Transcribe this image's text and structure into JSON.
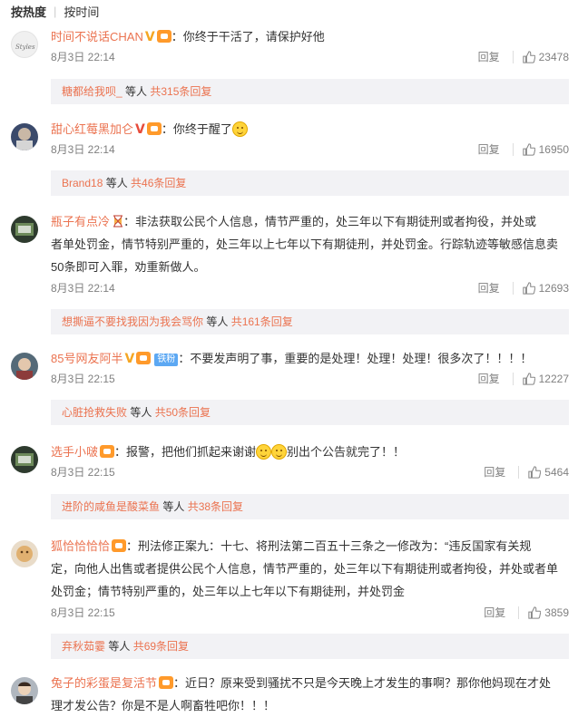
{
  "tabs": {
    "hot": "按热度",
    "time": "按时间"
  },
  "comments": [
    {
      "user": "时间不说话CHAN",
      "text": "：你终于干活了，请保护好他",
      "time": "8月3日 22:14",
      "reply_label": "回复",
      "likes": "23478",
      "sub": {
        "users": "糖都给我呗_",
        "mid": " 等人 ",
        "count": "共315条回复"
      }
    },
    {
      "user": "甜心红莓黑加仑",
      "text": "：你终于醒了",
      "time": "8月3日 22:14",
      "reply_label": "回复",
      "likes": "16950",
      "sub": {
        "users": "Brand18",
        "mid": " 等人 ",
        "count": "共46条回复"
      }
    },
    {
      "user": "瓶子有点冷",
      "text_line1": "：非法获取公民个人信息，情节严重的，处三年以下有期徒刑或者拘役，并处或",
      "text_line2": "者单处罚金，情节特别严重的，处三年以上七年以下有期徒刑，并处罚金。行踪轨迹等敏感信息卖",
      "text_line3": "50条即可入罪，劝重新做人。",
      "time": "8月3日 22:14",
      "reply_label": "回复",
      "likes": "12693",
      "sub": {
        "users": "想撕逼不要找我因为我会骂你",
        "mid": " 等人 ",
        "count": "共161条回复"
      }
    },
    {
      "user": "85号网友阿半",
      "tag": "铁粉",
      "text": "：不要发声明了事，重要的是处理！处理！处理！很多次了！！！！",
      "time": "8月3日 22:15",
      "reply_label": "回复",
      "likes": "12227",
      "sub": {
        "users": "心脏抢救失败",
        "mid": " 等人 ",
        "count": "共50条回复"
      }
    },
    {
      "user": "选手小啵",
      "text_a": "：报警，把他们抓起来谢谢",
      "text_b": "别出个公告就完了！！",
      "time": "8月3日 22:15",
      "reply_label": "回复",
      "likes": "5464",
      "sub": {
        "users": "进阶的咸鱼是酸菜鱼",
        "mid": " 等人 ",
        "count": "共38条回复"
      }
    },
    {
      "user": "狐恰恰恰恰",
      "text_line1": "：刑法修正案九：十七、将刑法第二百五十三条之一修改为：“违反国家有关规",
      "text_line2": "定，向他人出售或者提供公民个人信息，情节严重的，处三年以下有期徒刑或者拘役，并处或者单",
      "text_line3": "处罚金；情节特别严重的，处三年以上七年以下有期徒刑，并处罚金",
      "time": "8月3日 22:15",
      "reply_label": "回复",
      "likes": "3859",
      "sub": {
        "users": "弃秋茹霎",
        "mid": " 等人 ",
        "count": "共69条回复"
      }
    },
    {
      "user": "兔子的彩蛋是复活节",
      "text_line1": "：近日？原来受到骚扰不只是今天晚上才发生的事啊？那你他妈现在才处",
      "text_line2": "理才发公告？你是不是人啊畜牲吧你！！！"
    }
  ],
  "colors": {
    "name": "#eb7350",
    "meta": "#808080",
    "subbox_bg": "#f2f2f5",
    "gold_v": "#f5a623",
    "tag_bg": "#5ca8f3"
  },
  "icons": [
    "v-badge-icon",
    "vip-crown-icon",
    "hourglass-icon",
    "smiley-icon",
    "thumbs-up-icon"
  ]
}
